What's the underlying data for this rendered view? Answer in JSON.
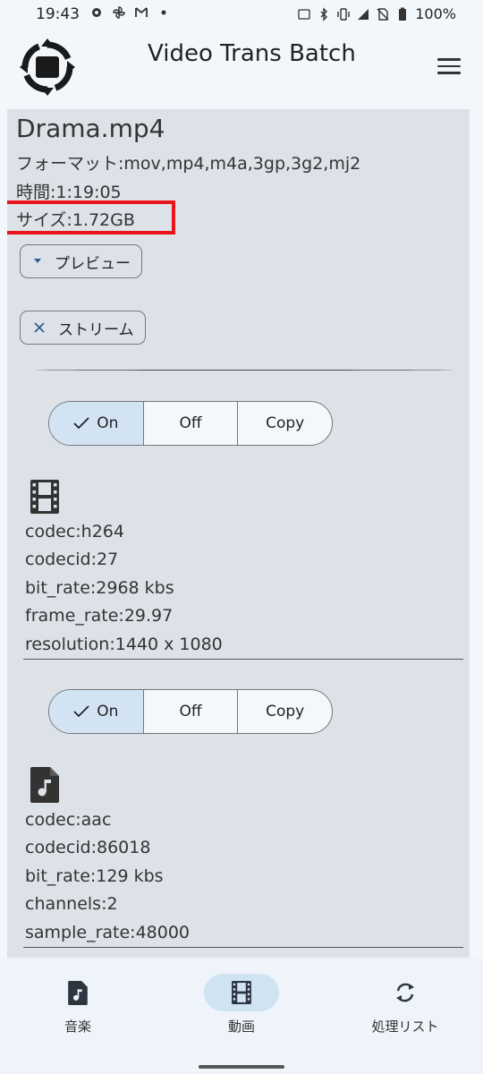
{
  "status_bar": {
    "time": "19:43",
    "battery": "100%"
  },
  "app_bar": {
    "title": "Video Trans Batch"
  },
  "file": {
    "name": "Drama.mp4",
    "format": "フォーマット:mov,mp4,m4a,3gp,3g2,mj2",
    "duration": "時間:1:19:05",
    "size": "サイズ:1.72GB"
  },
  "chips": {
    "preview": "プレビュー",
    "stream": "ストリーム"
  },
  "video_stream": {
    "toggle": {
      "on": "On",
      "off": "Off",
      "copy": "Copy",
      "selected": "On"
    },
    "codec": "codec:h264",
    "codecid": "codecid:27",
    "bit_rate": "bit_rate:2968 kbs",
    "frame_rate": "frame_rate:29.97",
    "resolution": "resolution:1440 x 1080"
  },
  "audio_stream": {
    "toggle": {
      "on": "On",
      "off": "Off",
      "copy": "Copy",
      "selected": "On"
    },
    "codec": "codec:aac",
    "codecid": "codecid:86018",
    "bit_rate": "bit_rate:129 kbs",
    "channels": "channels:2",
    "sample_rate": "sample_rate:48000"
  },
  "bottom_nav": [
    {
      "label": "音楽",
      "icon": "music-file-icon",
      "active": false
    },
    {
      "label": "動画",
      "icon": "film-icon",
      "active": true
    },
    {
      "label": "処理リスト",
      "icon": "sync-icon",
      "active": false
    }
  ],
  "colors": {
    "highlight": "#e8141a",
    "panel": "#dde2e8",
    "selected_segment": "#d2e4f4",
    "active_nav": "#cfe3f2"
  }
}
